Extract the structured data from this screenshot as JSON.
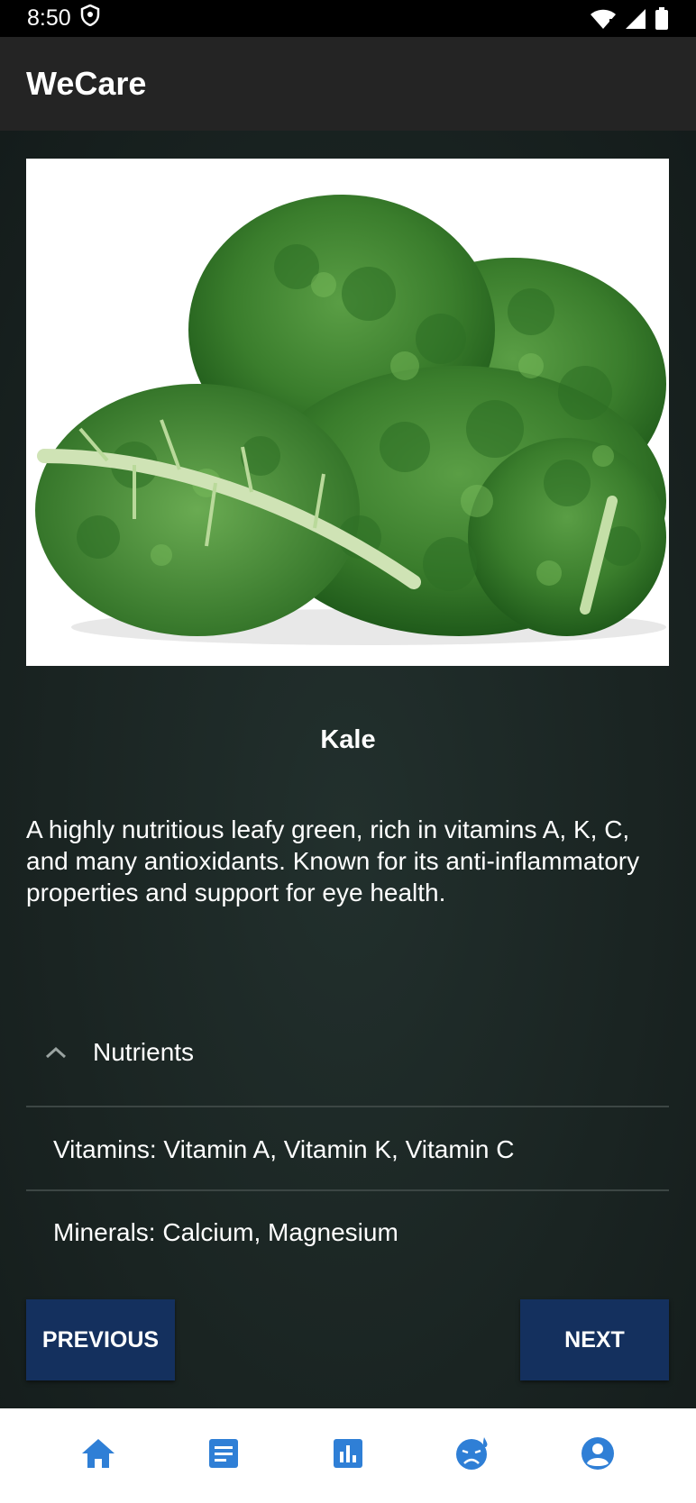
{
  "status_bar": {
    "time": "8:50"
  },
  "app_bar": {
    "title": "WeCare"
  },
  "food": {
    "name": "Kale",
    "description": "A highly nutritious leafy green, rich in vitamins A, K, C, and many antioxidants. Known for its anti-inflammatory properties and support for eye health."
  },
  "nutrients": {
    "header": "Nutrients",
    "expanded": true,
    "items": [
      "Vitamins: Vitamin A, Vitamin K, Vitamin C",
      "Minerals: Calcium, Magnesium"
    ]
  },
  "buttons": {
    "previous": "PREVIOUS",
    "next": "NEXT"
  },
  "bottom_nav": {
    "items": [
      {
        "icon": "home-icon",
        "active": true
      },
      {
        "icon": "article-icon",
        "active": false
      },
      {
        "icon": "bar-chart-icon",
        "active": false
      },
      {
        "icon": "sick-face-icon",
        "active": false
      },
      {
        "icon": "account-icon",
        "active": false
      }
    ]
  },
  "colors": {
    "accent": "#2f7fd6",
    "button": "#14305e",
    "background": "#1b2523",
    "app_bar": "#242424"
  }
}
